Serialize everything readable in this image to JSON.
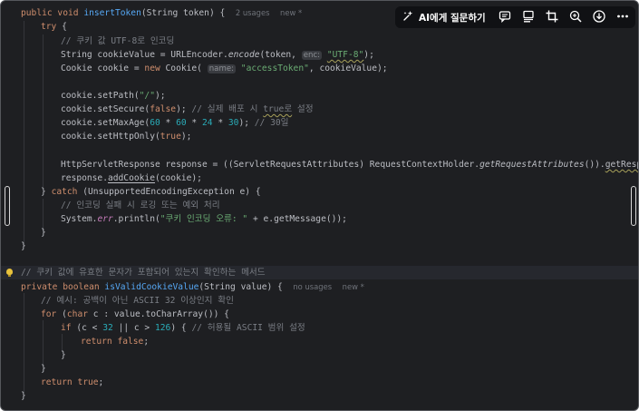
{
  "toolbar": {
    "ask_ai_label": "AI에게 질문하기",
    "icons": [
      "sparkle-icon",
      "chat-icon",
      "layout-icon",
      "crop-icon",
      "zoom-in-icon",
      "download-icon",
      "more-icon"
    ]
  },
  "code": {
    "insert_token": {
      "signature": {
        "mod": "public void ",
        "name": "insertToken",
        "params": "(String token) {",
        "usages": "2 usages",
        "status": "new *"
      },
      "try_kw": "try",
      "try_brace": " {",
      "comment_encode": "// 쿠키 값 UTF-8로 인코딩",
      "encode_pre": "String cookieValue = URLEncoder.",
      "encode_fn": "encode",
      "encode_mid": "(token, ",
      "enc_hint": "enc:",
      "utf8": "\"UTF-8\"",
      "encode_end": ");",
      "cookie_pre": "Cookie cookie = ",
      "cookie_new": "new",
      "cookie_ctor": " Cookie( ",
      "name_hint": "name:",
      "access_token": "\"accessToken\"",
      "cookie_end": ", cookieValue);",
      "path_pre": "cookie.setPath(",
      "path_val": "\"/\"",
      "path_end": ");",
      "secure_pre": "cookie.setSecure(",
      "false_kw": "false",
      "secure_end": "); ",
      "secure_comment_a": "// 실제 배포 시 ",
      "secure_comment_true": "true로",
      "secure_comment_b": " 설정",
      "maxage_pre": "cookie.setMaxAge(",
      "n60a": "60",
      "times": " * ",
      "n60b": "60",
      "n24": "24",
      "n30": "30",
      "maxage_end": "); ",
      "maxage_comment": "// 30일",
      "httponly_pre": "cookie.setHttpOnly(",
      "true_kw": "true",
      "httponly_end": ");",
      "response_pre": "HttpServletResponse response = ((ServletRequestAttributes) RequestContextHolder.",
      "get_attrs": "getRequestAttributes",
      "response_mid": "()).",
      "get_response": "getResponse",
      "response_end": "();",
      "add_pre": "response.",
      "add_fn": "addCookie",
      "add_end": "(cookie);",
      "catch_pre": "} ",
      "catch_kw": "catch",
      "catch_end": " (UnsupportedEncodingException e) {",
      "catch_comment": "// 인코딩 실패 시 로깅 또는 예외 처리",
      "println_pre": "System.",
      "err": "err",
      "println_mid": ".println(",
      "error_str": "\"쿠키 인코딩 오류: \"",
      "println_end": " + e.getMessage());",
      "close_try": "}",
      "close_method": "}"
    },
    "is_valid": {
      "doc_comment": "// 쿠키 값에 유효한 문자가 포함되어 있는지 확인하는 메서드",
      "mod": "private boolean ",
      "name": "isValidCookieValue",
      "params": "(String value) {",
      "usages": "no usages",
      "status": "new *",
      "example_comment": "// 예시: 공백이 아닌 ASCII 32 이상인지 확인",
      "for_kw": "for",
      "for_a": " (",
      "char_kw": "char",
      "for_b": " c : value.toCharArray()) {",
      "if_kw": "if",
      "if_a": " (c < ",
      "n32": "32",
      "if_b": " || c > ",
      "n126": "126",
      "if_c": ") { ",
      "range_comment": "// 허용될 ASCII 범위 설정",
      "return_kw": "return",
      "false_kw": "false",
      "semi": ";",
      "close_if": "}",
      "close_for": "}",
      "return2_kw": "return",
      "true_kw": "true",
      "close_method": "}"
    }
  }
}
